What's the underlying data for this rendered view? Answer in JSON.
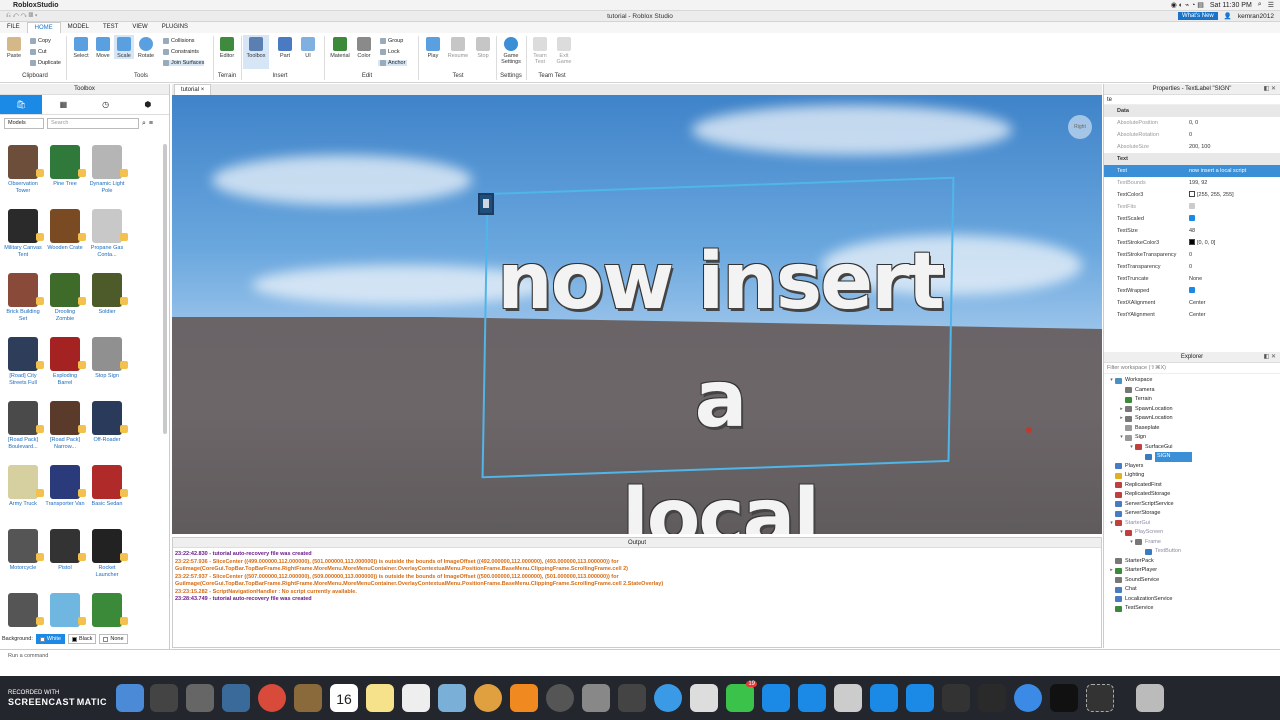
{
  "menubar": {
    "app_name": "RobloxStudio",
    "clock": "Sat 11:30 PM"
  },
  "window": {
    "title": "tutorial - Roblox Studio",
    "whats_new": "What's New",
    "username": "kemran2012"
  },
  "ribbon_tabs": {
    "file": "FILE",
    "home": "HOME",
    "model": "MODEL",
    "test": "TEST",
    "view": "VIEW",
    "plugins": "PLUGINS"
  },
  "ribbon": {
    "paste": "Paste",
    "copy": "Copy",
    "cut": "Cut",
    "duplicate": "Duplicate",
    "clipboard": "Clipboard",
    "select": "Select",
    "move": "Move",
    "scale": "Scale",
    "rotate": "Rotate",
    "tools": "Tools",
    "collisions": "Collisions",
    "constraints": "Constraints",
    "join_surfaces": "Join Surfaces",
    "editor": "Editor",
    "terrain": "Terrain",
    "toolbox": "Toolbox",
    "part": "Part",
    "ui": "UI",
    "insert": "Insert",
    "material": "Material",
    "color": "Color",
    "group": "Group",
    "lock": "Lock",
    "anchor": "Anchor",
    "edit": "Edit",
    "play": "Play",
    "resume": "Resume",
    "stop": "Stop",
    "test": "Test",
    "game_settings_1": "Game",
    "game_settings_2": "Settings",
    "settings": "Settings",
    "team_test_1": "Team",
    "team_test_2": "Test",
    "exit_game_1": "Exit",
    "exit_game_2": "Game",
    "team_test": "Team Test"
  },
  "toolbox": {
    "title": "Toolbox",
    "category": "Models",
    "search_placeholder": "Search",
    "items": [
      {
        "label": "Observation Tower",
        "color": "#6d4e3a"
      },
      {
        "label": "Pine Tree",
        "color": "#2f7a3a"
      },
      {
        "label": "Dynamic Light Pole",
        "color": "#b5b5b5"
      },
      {
        "label": "Military Canvas Tent",
        "color": "#2a2a2a"
      },
      {
        "label": "Wooden Crate",
        "color": "#7a4a22"
      },
      {
        "label": "Propane Gas Conta...",
        "color": "#c8c8c8"
      },
      {
        "label": "Brick Building Set",
        "color": "#8a4a3a"
      },
      {
        "label": "Drooling Zombie",
        "color": "#3f6b2a"
      },
      {
        "label": "Soldier",
        "color": "#4d5a2a"
      },
      {
        "label": "[Road] City Streets Full",
        "color": "#2d3d5a"
      },
      {
        "label": "Exploding Barrel",
        "color": "#a52222"
      },
      {
        "label": "Stop Sign",
        "color": "#909090"
      },
      {
        "label": "[Road Pack] Boulevard...",
        "color": "#4a4a4a"
      },
      {
        "label": "[Road Pack] Narrow...",
        "color": "#5a3a2a"
      },
      {
        "label": "Off-Roader",
        "color": "#2a3a5a"
      },
      {
        "label": "Army Truck",
        "color": "#d6cfa0"
      },
      {
        "label": "Transporter Van",
        "color": "#2a3a7a"
      },
      {
        "label": "Basic Sedan",
        "color": "#b02a2a"
      },
      {
        "label": "Motorcycle",
        "color": "#555555"
      },
      {
        "label": "Pistol",
        "color": "#333333"
      },
      {
        "label": "Rocket Launcher",
        "color": "#222222"
      },
      {
        "label": "",
        "color": "#555555"
      },
      {
        "label": "",
        "color": "#6fb6e0"
      },
      {
        "label": "",
        "color": "#3a8a3a"
      }
    ],
    "background_label": "Background:",
    "bg_white": "White",
    "bg_black": "Black",
    "bg_none": "None"
  },
  "doc_tab": {
    "label": "tutorial"
  },
  "viewport": {
    "sign_line1": "now insert a",
    "sign_line2": "local script",
    "viewcube_label": "Right"
  },
  "output": {
    "title": "Output",
    "lines": [
      {
        "text": "23:22:42.830 - tutorial auto-recovery file was created",
        "kind": "info"
      },
      {
        "text": "23:22:57.936 - SliceCenter ((499.000000,112.000000), (501.000000,113.000000)) is outside the bounds of ImageOffset ((492.000000,112.000000), (493.000000,113.000000)) for",
        "kind": "warn"
      },
      {
        "text": "GuiImage(CoreGui.TopBar.TopBarFrame.RightFrame.MoreMenu.MoreMenuContainer.OverlayContextualMenu.PositionFrame.BaseMenu.ClippingFrame.ScrollingFrame.cell 2)",
        "kind": "warn"
      },
      {
        "text": "23:22:57.937 - SliceCenter ((507.000000,112.000000), (509.000000,113.000000)) is outside the bounds of ImageOffset ((500.000000,112.000000), (501.000000,113.000000)) for",
        "kind": "warn"
      },
      {
        "text": "GuiImage(CoreGui.TopBar.TopBarFrame.RightFrame.MoreMenu.MoreMenuContainer.OverlayContextualMenu.PositionFrame.BaseMenu.ClippingFrame.ScrollingFrame.cell 2.StateOverlay)",
        "kind": "warn"
      },
      {
        "text": "23:23:15.282 - ScriptNavigationHandler : No script currently available.",
        "kind": "warn"
      },
      {
        "text": "23:28:43.749 - tutorial auto-recovery file was created",
        "kind": "info"
      }
    ]
  },
  "properties": {
    "title": "Properties - TextLabel \"SIGN\"",
    "filter": "te",
    "rows": [
      {
        "name": "Data",
        "value": "",
        "type": "cat"
      },
      {
        "name": "AbsolutePosition",
        "value": "0, 0",
        "type": "dim"
      },
      {
        "name": "AbsoluteRotation",
        "value": "0",
        "type": "dim"
      },
      {
        "name": "AbsoluteSize",
        "value": "200, 100",
        "type": "dim"
      },
      {
        "name": "Text",
        "value": "",
        "type": "cat"
      },
      {
        "name": "Text",
        "value": "now insert a local script",
        "type": "sel"
      },
      {
        "name": "TextBounds",
        "value": "199, 92",
        "type": "dim"
      },
      {
        "name": "TextColor3",
        "value": "[255, 255, 255]",
        "type": "norm"
      },
      {
        "name": "TextFits",
        "value": "",
        "type": "dim"
      },
      {
        "name": "TextScaled",
        "value": "",
        "type": "norm"
      },
      {
        "name": "TextSize",
        "value": "48",
        "type": "norm"
      },
      {
        "name": "TextStrokeColor3",
        "value": "[0, 0, 0]",
        "type": "norm"
      },
      {
        "name": "TextStrokeTransparency",
        "value": "0",
        "type": "norm"
      },
      {
        "name": "TextTransparency",
        "value": "0",
        "type": "norm"
      },
      {
        "name": "TextTruncate",
        "value": "None",
        "type": "norm"
      },
      {
        "name": "TextWrapped",
        "value": "",
        "type": "norm"
      },
      {
        "name": "TextXAlignment",
        "value": "Center",
        "type": "norm"
      },
      {
        "name": "TextYAlignment",
        "value": "Center",
        "type": "norm"
      }
    ]
  },
  "explorer": {
    "title": "Explorer",
    "filter_placeholder": "Filter workspace (⇧⌘X)",
    "items": [
      {
        "label": "Workspace",
        "indent": 0,
        "arrow": "▾",
        "color": "#4a90c2"
      },
      {
        "label": "Camera",
        "indent": 1,
        "arrow": "",
        "color": "#777"
      },
      {
        "label": "Terrain",
        "indent": 1,
        "arrow": "",
        "color": "#3a8a3a"
      },
      {
        "label": "SpawnLocation",
        "indent": 1,
        "arrow": "▸",
        "color": "#777"
      },
      {
        "label": "SpawnLocation",
        "indent": 1,
        "arrow": "▸",
        "color": "#777"
      },
      {
        "label": "Baseplate",
        "indent": 1,
        "arrow": "",
        "color": "#999"
      },
      {
        "label": "Sign",
        "indent": 1,
        "arrow": "▾",
        "color": "#999"
      },
      {
        "label": "SurfaceGui",
        "indent": 2,
        "arrow": "▾",
        "color": "#c04040"
      },
      {
        "label": "SIGN",
        "indent": 3,
        "arrow": "",
        "color": "#3a7ac2",
        "selected": true
      },
      {
        "label": "Players",
        "indent": 0,
        "arrow": "",
        "color": "#4a7ac2"
      },
      {
        "label": "Lighting",
        "indent": 0,
        "arrow": "",
        "color": "#e0b020"
      },
      {
        "label": "ReplicatedFirst",
        "indent": 0,
        "arrow": "",
        "color": "#c04040"
      },
      {
        "label": "ReplicatedStorage",
        "indent": 0,
        "arrow": "",
        "color": "#c04040"
      },
      {
        "label": "ServerScriptService",
        "indent": 0,
        "arrow": "",
        "color": "#4a7ac2"
      },
      {
        "label": "ServerStorage",
        "indent": 0,
        "arrow": "",
        "color": "#4a7ac2"
      },
      {
        "label": "StarterGui",
        "indent": 0,
        "arrow": "▾",
        "color": "#c04040",
        "dim": true
      },
      {
        "label": "PlayScreen",
        "indent": 1,
        "arrow": "▾",
        "color": "#c04040",
        "dim": true
      },
      {
        "label": "Frame",
        "indent": 2,
        "arrow": "▾",
        "color": "#777",
        "dim": true
      },
      {
        "label": "TextButton",
        "indent": 3,
        "arrow": "",
        "color": "#3a7ac2",
        "dim": true
      },
      {
        "label": "StarterPack",
        "indent": 0,
        "arrow": "",
        "color": "#777"
      },
      {
        "label": "StarterPlayer",
        "indent": 0,
        "arrow": "▸",
        "color": "#3a8a3a"
      },
      {
        "label": "SoundService",
        "indent": 0,
        "arrow": "",
        "color": "#777"
      },
      {
        "label": "Chat",
        "indent": 0,
        "arrow": "",
        "color": "#4a7ac2"
      },
      {
        "label": "LocalizationService",
        "indent": 0,
        "arrow": "",
        "color": "#4a7ac2"
      },
      {
        "label": "TestService",
        "indent": 0,
        "arrow": "",
        "color": "#3a8a3a"
      }
    ]
  },
  "command_bar": {
    "placeholder": "Run a command"
  },
  "dock": {
    "watermark_top": "RECORDED WITH",
    "watermark_brand": "SCREENCAST",
    "watermark_tail": "MATIC",
    "calendar_day": "16",
    "mail_badge": "19"
  }
}
